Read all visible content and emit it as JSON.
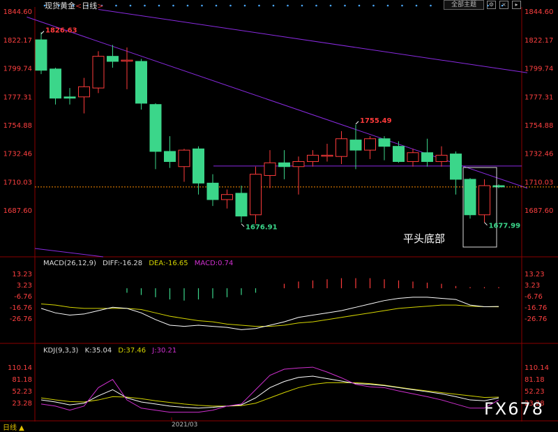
{
  "title": {
    "name": "现货黄金",
    "period": "日线"
  },
  "toolbar": {
    "main_select": "全部主题",
    "icons": [
      "settings-icon",
      "close-icon",
      "arrow-icon"
    ]
  },
  "bottom_left": "日线 ▲",
  "date_label": "2021/03",
  "watermark": "FX678",
  "annotation": "平头底部",
  "colors": {
    "up": "#ff3b3b",
    "down": "#3bd68a",
    "trendline": "#8a2be2",
    "diff": "#ffffff",
    "dea": "#d6d600",
    "k": "#ffffff",
    "d": "#d6d600",
    "j": "#d030d0",
    "dotted": "#ff8c00"
  },
  "macd": {
    "label": "MACD(26,12,9)",
    "diff": "DIFF:-16.28",
    "dea": "DEA:-16.65",
    "macd": "MACD:0.74"
  },
  "kdj": {
    "label": "KDJ(9,3,3)",
    "k": "K:35.04",
    "d": "D:37.46",
    "j": "J:30.21"
  },
  "chart_data": [
    {
      "type": "candlestick",
      "y_ticks": [
        "1844.60",
        "1822.17",
        "1799.74",
        "1777.31",
        "1754.88",
        "1732.46",
        "1710.03",
        "1687.60"
      ],
      "ylim": [
        1665.17,
        1844.6
      ],
      "candles": [
        {
          "o": 1822,
          "h": 1828,
          "l": 1795,
          "c": 1798
        },
        {
          "o": 1799,
          "h": 1800,
          "l": 1771,
          "c": 1776
        },
        {
          "o": 1777,
          "h": 1784,
          "l": 1771,
          "c": 1776
        },
        {
          "o": 1777,
          "h": 1792,
          "l": 1764,
          "c": 1785
        },
        {
          "o": 1784,
          "h": 1813,
          "l": 1780,
          "c": 1809
        },
        {
          "o": 1809,
          "h": 1818,
          "l": 1800,
          "c": 1805
        },
        {
          "o": 1806,
          "h": 1816,
          "l": 1783,
          "c": 1806
        },
        {
          "o": 1805,
          "h": 1807,
          "l": 1767,
          "c": 1772
        },
        {
          "o": 1771,
          "h": 1772,
          "l": 1720,
          "c": 1734
        },
        {
          "o": 1734,
          "h": 1746,
          "l": 1721,
          "c": 1726
        },
        {
          "o": 1722,
          "h": 1736,
          "l": 1710,
          "c": 1735
        },
        {
          "o": 1736,
          "h": 1738,
          "l": 1700,
          "c": 1709
        },
        {
          "o": 1709,
          "h": 1716,
          "l": 1691,
          "c": 1696
        },
        {
          "o": 1696,
          "h": 1704,
          "l": 1689,
          "c": 1700
        },
        {
          "o": 1701,
          "h": 1707,
          "l": 1678,
          "c": 1683
        },
        {
          "o": 1684,
          "h": 1722,
          "l": 1677,
          "c": 1716
        },
        {
          "o": 1715,
          "h": 1735,
          "l": 1705,
          "c": 1725
        },
        {
          "o": 1725,
          "h": 1735,
          "l": 1712,
          "c": 1722
        },
        {
          "o": 1722,
          "h": 1730,
          "l": 1700,
          "c": 1726
        },
        {
          "o": 1726,
          "h": 1735,
          "l": 1722,
          "c": 1731
        },
        {
          "o": 1731,
          "h": 1740,
          "l": 1726,
          "c": 1731
        },
        {
          "o": 1730,
          "h": 1750,
          "l": 1724,
          "c": 1744
        },
        {
          "o": 1743,
          "h": 1755,
          "l": 1720,
          "c": 1735
        },
        {
          "o": 1735,
          "h": 1746,
          "l": 1728,
          "c": 1744
        },
        {
          "o": 1744,
          "h": 1746,
          "l": 1727,
          "c": 1738
        },
        {
          "o": 1738,
          "h": 1742,
          "l": 1725,
          "c": 1726
        },
        {
          "o": 1726,
          "h": 1736,
          "l": 1722,
          "c": 1733
        },
        {
          "o": 1733,
          "h": 1744,
          "l": 1722,
          "c": 1726
        },
        {
          "o": 1726,
          "h": 1738,
          "l": 1722,
          "c": 1731
        },
        {
          "o": 1732,
          "h": 1734,
          "l": 1700,
          "c": 1712
        },
        {
          "o": 1712,
          "h": 1713,
          "l": 1681,
          "c": 1684
        },
        {
          "o": 1684,
          "h": 1712,
          "l": 1678,
          "c": 1707
        },
        {
          "o": 1707,
          "h": 1708,
          "l": 1705,
          "c": 1706
        }
      ],
      "labels": [
        {
          "text": "1826.63",
          "i": 0,
          "v": 1826.63,
          "color": "up"
        },
        {
          "text": "1755.49",
          "i": 22,
          "v": 1755.49,
          "color": "up"
        },
        {
          "text": "1676.91",
          "i": 14,
          "v": 1676.91,
          "color": "down"
        },
        {
          "text": "1677.99",
          "i": 31,
          "v": 1677.99,
          "color": "down"
        }
      ],
      "dotted_level": 1706,
      "h_level": 1722.5,
      "lines": [
        {
          "from": [
            -1,
            1840
          ],
          "to": [
            34,
            1705
          ]
        },
        {
          "from": [
            4,
            1846
          ],
          "to": [
            34,
            1796
          ]
        }
      ]
    },
    {
      "type": "bar",
      "name": "MACD",
      "y_ticks": [
        "13.23",
        "3.23",
        "-6.76",
        "-16.76",
        "-26.76"
      ],
      "ylim": [
        -36.76,
        16.23
      ],
      "macd_bars": [
        0,
        0,
        0,
        0,
        0,
        0,
        -4,
        -6,
        -8,
        -10,
        -11,
        -10,
        -9,
        -8,
        -6,
        -4,
        0,
        4,
        6,
        7,
        8,
        9,
        9,
        9,
        8,
        7,
        6,
        5,
        4,
        2,
        1,
        1,
        1
      ],
      "diff": [
        -18,
        -22,
        -24,
        -23,
        -20,
        -17,
        -18,
        -22,
        -28,
        -33,
        -34,
        -33,
        -34,
        -35,
        -37,
        -36,
        -33,
        -30,
        -26,
        -24,
        -22,
        -20,
        -17,
        -14,
        -11,
        -9,
        -8,
        -8,
        -9,
        -10,
        -15,
        -16.5,
        -16.3
      ],
      "dea": [
        -14,
        -15,
        -17,
        -18,
        -18,
        -18,
        -18,
        -19,
        -22,
        -25,
        -27,
        -29,
        -30,
        -32,
        -33,
        -34,
        -34,
        -33,
        -31,
        -30,
        -28,
        -26,
        -24,
        -22,
        -20,
        -18,
        -17,
        -16,
        -15,
        -15,
        -16,
        -16.5,
        -16.6
      ]
    },
    {
      "type": "line",
      "name": "KDJ",
      "y_ticks": [
        "110.14",
        "81.18",
        "52.23",
        "23.28"
      ],
      "ylim": [
        -5.67,
        110.14
      ],
      "k": [
        30,
        25,
        18,
        22,
        40,
        55,
        35,
        25,
        20,
        15,
        12,
        10,
        12,
        15,
        18,
        35,
        60,
        75,
        85,
        88,
        82,
        76,
        70,
        68,
        65,
        60,
        55,
        50,
        45,
        38,
        30,
        28,
        35
      ],
      "d": [
        35,
        30,
        26,
        25,
        30,
        38,
        37,
        33,
        28,
        24,
        20,
        17,
        15,
        15,
        16,
        22,
        35,
        48,
        60,
        68,
        72,
        72,
        72,
        70,
        66,
        61,
        56,
        52,
        48,
        44,
        40,
        36,
        37
      ],
      "j": [
        20,
        15,
        5,
        15,
        60,
        80,
        30,
        10,
        5,
        0,
        0,
        0,
        5,
        15,
        20,
        55,
        90,
        105,
        108,
        110,
        98,
        84,
        68,
        62,
        60,
        52,
        45,
        38,
        30,
        20,
        10,
        10,
        30
      ]
    }
  ]
}
